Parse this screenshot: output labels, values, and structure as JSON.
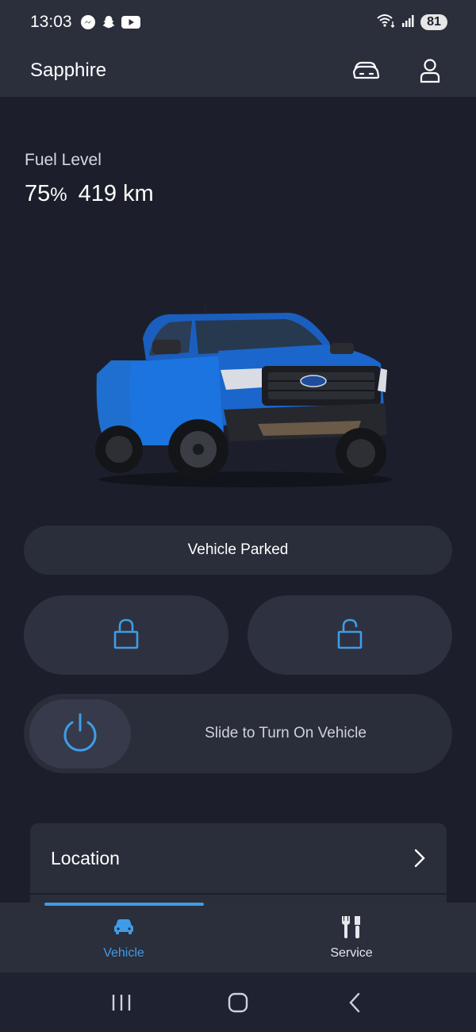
{
  "status_bar": {
    "time": "13:03",
    "apps": [
      "messenger-icon",
      "snapchat-icon",
      "youtube-icon"
    ],
    "battery": "81"
  },
  "header": {
    "vehicle_name": "Sapphire",
    "actions": [
      "garage-icon",
      "profile-icon"
    ]
  },
  "fuel": {
    "label": "Fuel Level",
    "percent_value": "75",
    "percent_unit": "%",
    "range": "419 km"
  },
  "vehicle_status": "Vehicle Parked",
  "controls": {
    "lock_icon": "lock-closed-icon",
    "unlock_icon": "lock-open-icon",
    "slider_text": "Slide to Turn On Vehicle",
    "power_icon": "power-icon"
  },
  "location_card": {
    "title": "Location"
  },
  "tabs": [
    {
      "label": "Vehicle",
      "icon": "car-icon",
      "active": true
    },
    {
      "label": "Service",
      "icon": "tools-icon",
      "active": false
    }
  ],
  "colors": {
    "accent": "#3f9ce6",
    "background": "#1c1f2b",
    "surface": "#2a2d3a"
  }
}
